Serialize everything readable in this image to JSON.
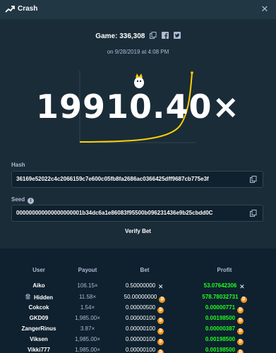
{
  "titlebar": {
    "title": "Crash",
    "icon": "chart-line-icon",
    "close_icon": "close-icon"
  },
  "game": {
    "label": "Game: 336,308",
    "date": "on 9/28/2019 at 4:08 PM",
    "multiplier": "19910.40×"
  },
  "hash": {
    "label": "Hash",
    "value": "36169e52022c4c2066159c7e600c05fb8fa2686ac0366425dff9687cb775e3f"
  },
  "seed": {
    "label": "Seed",
    "value": "000000000000000000001b34dc6a1e86083f95500b096231436e9b25cbdd0C"
  },
  "verify_label": "Verify Bet",
  "table": {
    "headers": {
      "user": "User",
      "payout": "Payout",
      "bet": "Bet",
      "profit": "Profit"
    },
    "rows": [
      {
        "user": "Aiko",
        "payout": "106.15×",
        "bet": "0.50000000",
        "bet_currency": "xrp",
        "profit": "53.07642306",
        "profit_currency": "xrp",
        "hidden": false
      },
      {
        "user": "Hidden",
        "payout": "11.58×",
        "bet": "50.00000000",
        "bet_currency": "btc",
        "profit": "578.78032731",
        "profit_currency": "btc",
        "hidden": true
      },
      {
        "user": "Cokcok",
        "payout": "1.54×",
        "bet": "0.00000500",
        "bet_currency": "btc",
        "profit": "0.00000771",
        "profit_currency": "btc",
        "hidden": false
      },
      {
        "user": "GKD09",
        "payout": "1,985.00×",
        "bet": "0.00000100",
        "bet_currency": "btc",
        "profit": "0.00198500",
        "profit_currency": "btc",
        "hidden": false
      },
      {
        "user": "ZangerRinus",
        "payout": "3.87×",
        "bet": "0.00000100",
        "bet_currency": "btc",
        "profit": "0.00000387",
        "profit_currency": "btc",
        "hidden": false
      },
      {
        "user": "Viksen",
        "payout": "1,985.00×",
        "bet": "0.00000100",
        "bet_currency": "btc",
        "profit": "0.00198500",
        "profit_currency": "btc",
        "hidden": false
      },
      {
        "user": "Vikki777",
        "payout": "1,985.00×",
        "bet": "0.00000100",
        "bet_currency": "btc",
        "profit": "0.00198500",
        "profit_currency": "btc",
        "hidden": false
      }
    ]
  },
  "colors": {
    "background": "#1a2c38",
    "panel": "#0f212e",
    "profit": "#1fff20",
    "curve": "#ffd000",
    "btc": "#f7931a"
  }
}
